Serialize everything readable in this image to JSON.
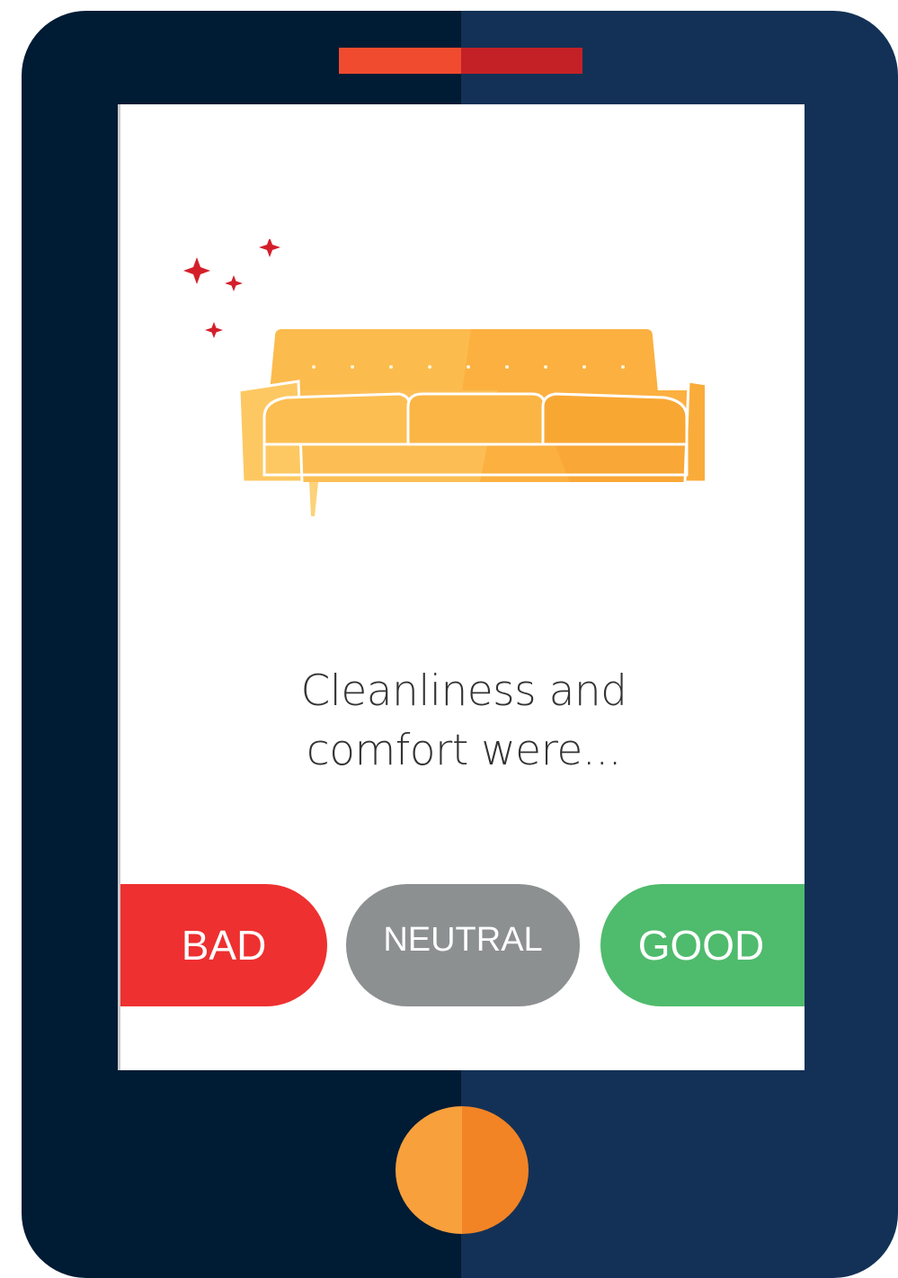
{
  "survey": {
    "question_line1": "Cleanliness and",
    "question_line2": "comfort were...",
    "options": [
      {
        "label": "BAD",
        "color": "#ee3030"
      },
      {
        "label": "NEUTRAL",
        "color": "#8d9091"
      },
      {
        "label": "GOOD",
        "color": "#4fbb6d"
      }
    ]
  },
  "illustration": {
    "icon": "sofa-icon",
    "sparkle_icon": "sparkle-icon",
    "sparkle_color": "#d41f2b",
    "sofa_color": "#fbb040"
  },
  "device": {
    "body_left_color": "#001b34",
    "body_right_color": "#133156",
    "speaker_colors": [
      "#f04b2f",
      "#c42127"
    ],
    "home_button_colors": [
      "#f7a03c",
      "#f28425"
    ]
  }
}
